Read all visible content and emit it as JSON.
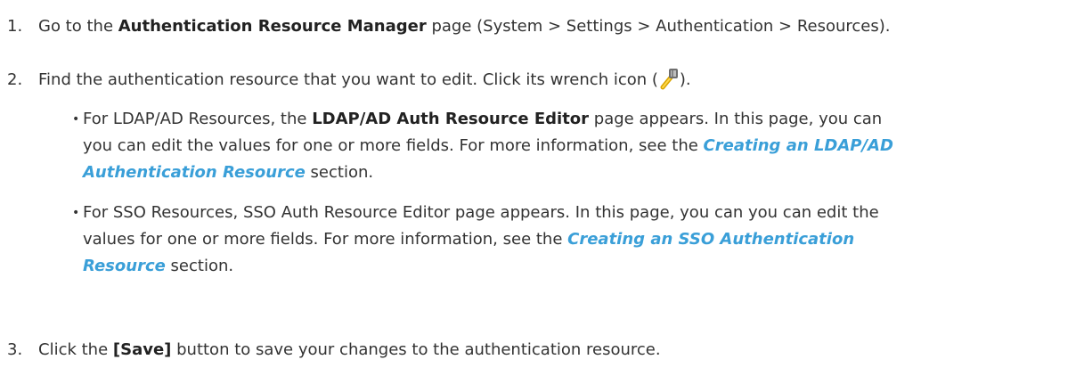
{
  "steps": [
    {
      "num": "1.",
      "pre": "Go to the ",
      "bold": "Authentication Resource Manager",
      "post": " page (System > Settings > Authentication > Resources)."
    },
    {
      "num": "2.",
      "pre": "Find the authentication resource that you want to edit. Click its wrench icon (",
      "post": ")."
    },
    {
      "num": "3.",
      "pre": "Click the ",
      "bold": "[Save]",
      "post": " button to save your changes to the authentication resource."
    }
  ],
  "bullets": [
    {
      "line1_pre": "For LDAP/AD Resources, the ",
      "line1_bold": "LDAP/AD Auth Resource Editor",
      "line1_post": " page appears. In this page, you can",
      "line2_pre": "you can edit the values for one or more fields. For more information, see the ",
      "link1": "Creating an LDAP/AD",
      "link2": "Authentication Resource",
      "line3_post": " section."
    },
    {
      "line1": "For SSO Resources, SSO Auth Resource Editor page appears. In this page, you can you can edit the",
      "line2_pre": "values for one or more fields. For more information, see the ",
      "link1": "Creating an SSO Authentication",
      "link2": "Resource",
      "line3_post": " section."
    }
  ],
  "icons": {
    "wrench": "wrench-icon"
  }
}
